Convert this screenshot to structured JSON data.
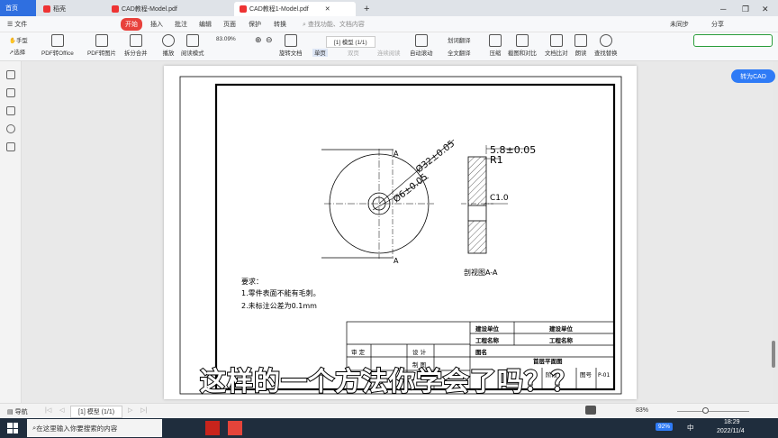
{
  "tabs": [
    {
      "label": "首页",
      "active": true
    },
    {
      "label": "稻壳"
    },
    {
      "label": "CAD教程-Model.pdf"
    },
    {
      "label": "CAD教程1-Model.pdf",
      "active_doc": true
    }
  ],
  "menu": {
    "file": "文件",
    "items": [
      "开始",
      "插入",
      "批注",
      "编辑",
      "页面",
      "保护",
      "转换"
    ],
    "search_placeholder": "查找功能、文档内容",
    "right": [
      "未同步",
      "分享"
    ]
  },
  "toolbar": {
    "hand": "手型",
    "select": "选择",
    "tools": [
      "PDF转Office",
      "PDF转图片",
      "拆分合并",
      "播放",
      "阅读模式",
      "旋转文档",
      "单页",
      "双页",
      "连续阅读",
      "自动滚动",
      "划词翻译",
      "全文翻译",
      "压缩",
      "截图和对比",
      "文档比对",
      "朗读",
      "查找替换"
    ],
    "zoom": "83.09%",
    "page_indicator": "[1] 模型 (1/1)"
  },
  "to_cad": "转为CAD",
  "drawing": {
    "dia_outer": "Ø32±0.05",
    "dia_inner": "Ø6±0.05",
    "section_mark": "A",
    "width_dim": "5.8±0.05",
    "radius": "R1",
    "chamfer": "C1.0",
    "section_label": "剖视图A-A",
    "notes_title": "要求：",
    "notes": [
      "1.零件表面不能有毛刺。",
      "2.未标注公差为0.1mm"
    ],
    "title_block": {
      "unit_label": "建设单位",
      "unit_value": "建设单位",
      "project_label": "工程名称",
      "project_value": "工程名称",
      "drawing_name_label": "图名",
      "drawing_name_value": "首层平面图",
      "review": "审 定",
      "design": "设 计",
      "draw": "制 图",
      "stage_label": "阶段",
      "number_label": "图号",
      "number_value": "P-01"
    }
  },
  "subtitle": "这样的一个方法你学会了吗？？",
  "status": {
    "nav": "导航",
    "page": "[1] 模型 (1/1)",
    "zoom": "83%"
  },
  "taskbar": {
    "search": "在这里输入你要搜索的内容",
    "battery": "92%",
    "ime": "中",
    "time": "18:29",
    "date": "2022/11/4"
  }
}
